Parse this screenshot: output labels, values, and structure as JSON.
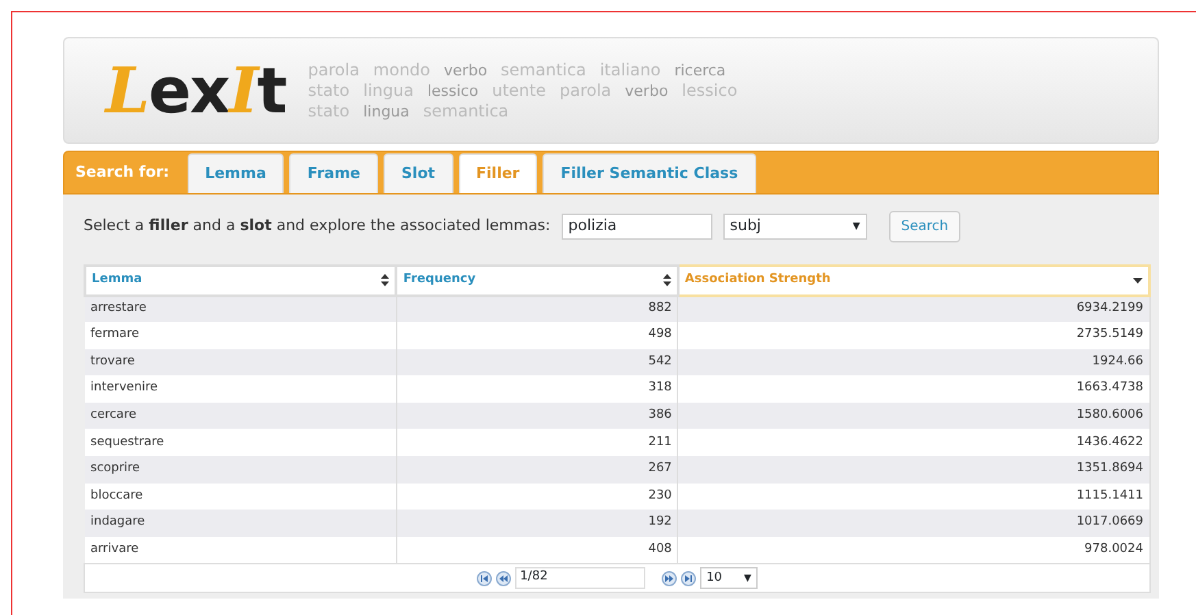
{
  "logo": {
    "text_parts": [
      {
        "text": "L",
        "accent": true
      },
      {
        "text": "ex",
        "accent": false
      },
      {
        "text": "I",
        "accent": true
      },
      {
        "text": "t",
        "accent": false
      }
    ]
  },
  "word_cloud": [
    "parola",
    "mondo",
    "verbo",
    "semantica",
    "italiano",
    "ricerca",
    "stato",
    "lingua",
    "lessico",
    "utente",
    "parola",
    "verbo",
    "lessico",
    "stato",
    "lingua",
    "semantica"
  ],
  "search_bar": {
    "label": "Search for:",
    "tabs": [
      {
        "label": "Lemma",
        "selected": false
      },
      {
        "label": "Frame",
        "selected": false
      },
      {
        "label": "Slot",
        "selected": false
      },
      {
        "label": "Filler",
        "selected": true
      },
      {
        "label": "Filler Semantic Class",
        "selected": false
      }
    ]
  },
  "query": {
    "prompt": "Select a **filler** and a **slot** and explore the associated lemmas:",
    "filler_value": "polizia",
    "slot_value": "subj",
    "slot_caret": "▼",
    "button": "Search"
  },
  "table": {
    "columns": [
      {
        "label": "Lemma",
        "sorted": false
      },
      {
        "label": "Frequency",
        "sorted": false
      },
      {
        "label": "Association Strength",
        "sorted": true
      }
    ],
    "rows": [
      [
        "arrestare",
        "882",
        "6934.2199"
      ],
      [
        "fermare",
        "498",
        "2735.5149"
      ],
      [
        "trovare",
        "542",
        "1924.66"
      ],
      [
        "intervenire",
        "318",
        "1663.4738"
      ],
      [
        "cercare",
        "386",
        "1580.6006"
      ],
      [
        "sequestrare",
        "211",
        "1436.4622"
      ],
      [
        "scoprire",
        "267",
        "1351.8694"
      ],
      [
        "bloccare",
        "230",
        "1115.1411"
      ],
      [
        "indagare",
        "192",
        "1017.0669"
      ],
      [
        "arrivare",
        "408",
        "978.0024"
      ]
    ]
  },
  "pager": {
    "page": "1/82",
    "page_size": "10",
    "page_size_caret": "▼"
  }
}
